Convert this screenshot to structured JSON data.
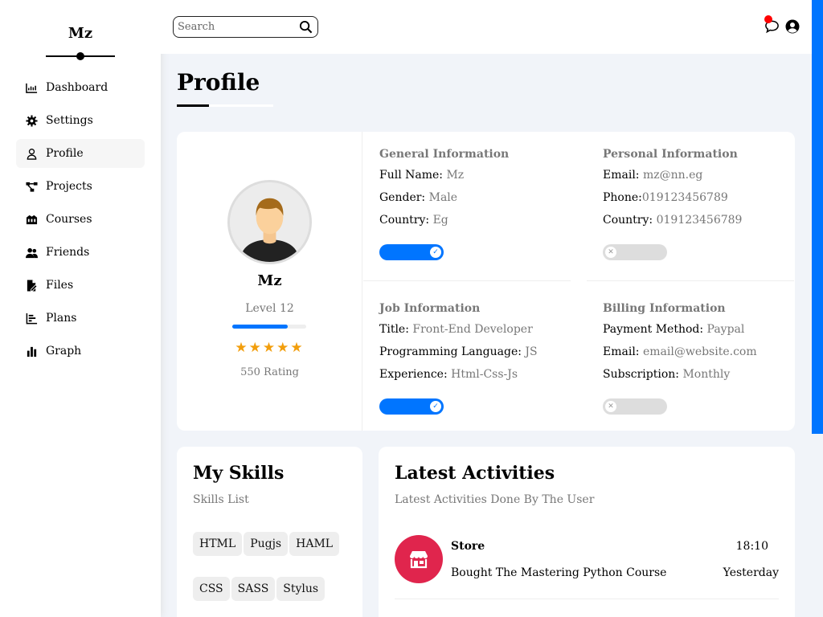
{
  "sidebar": {
    "brand": "Mz",
    "items": [
      {
        "label": "Dashboard",
        "icon": "chart-line-icon"
      },
      {
        "label": "Settings",
        "icon": "gear-icon"
      },
      {
        "label": "Profile",
        "icon": "user-icon",
        "active": true
      },
      {
        "label": "Projects",
        "icon": "diagram-project-icon"
      },
      {
        "label": "Courses",
        "icon": "graduation-cap-icon"
      },
      {
        "label": "Friends",
        "icon": "users-icon"
      },
      {
        "label": "Files",
        "icon": "file-icon"
      },
      {
        "label": "Plans",
        "icon": "chart-bar-icon"
      },
      {
        "label": "Graph",
        "icon": "chart-column-icon"
      }
    ]
  },
  "header": {
    "search_placeholder": "Search",
    "icons": [
      "search-icon",
      "chat-icon",
      "user-circle-icon"
    ]
  },
  "page": {
    "title": "Profile"
  },
  "profile": {
    "name": "Mz",
    "level": "Level 12",
    "level_progress": 0.75,
    "stars": "★★★★★",
    "rating": "550 Rating"
  },
  "general": {
    "title": "General Information",
    "rows": [
      {
        "k": "Full Name:",
        "v": "Mz"
      },
      {
        "k": "Gender:",
        "v": "Male"
      },
      {
        "k": "Country:",
        "v": "Eg"
      }
    ],
    "toggle": true
  },
  "personal": {
    "title": "Personal Information",
    "rows": [
      {
        "k": "Email:",
        "v": "mz@nn.eg"
      },
      {
        "k": "Phone:",
        "v": "019123456789"
      },
      {
        "k": "Country:",
        "v": "019123456789"
      }
    ],
    "toggle": false
  },
  "job": {
    "title": "Job Information",
    "rows": [
      {
        "k": "Title:",
        "v": "Front-End Developer"
      },
      {
        "k": "Programming Language:",
        "v": "JS"
      },
      {
        "k": "Experience:",
        "v": "Html-Css-Js"
      }
    ],
    "toggle": true
  },
  "billing": {
    "title": "Billing Information",
    "rows": [
      {
        "k": "Payment Method:",
        "v": "Paypal"
      },
      {
        "k": "Email:",
        "v": "email@website.com"
      },
      {
        "k": "Subscription:",
        "v": "Monthly"
      }
    ],
    "toggle": false
  },
  "skills": {
    "title": "My Skills",
    "subtitle": "Skills List",
    "list": [
      "HTML",
      "Pugjs",
      "HAML",
      "CSS",
      "SASS",
      "Stylus"
    ]
  },
  "activities": {
    "title": "Latest Activities",
    "subtitle": "Latest Activities Done By The User",
    "items": [
      {
        "name": "Store",
        "desc": "Bought The Mastering Python Course",
        "time": "18:10",
        "day": "Yesterday",
        "icon": "store-icon"
      }
    ]
  },
  "colors": {
    "accent": "#0075ff",
    "star": "#f29e0c",
    "activity": "#e0254d",
    "notify": "#ff0000"
  }
}
